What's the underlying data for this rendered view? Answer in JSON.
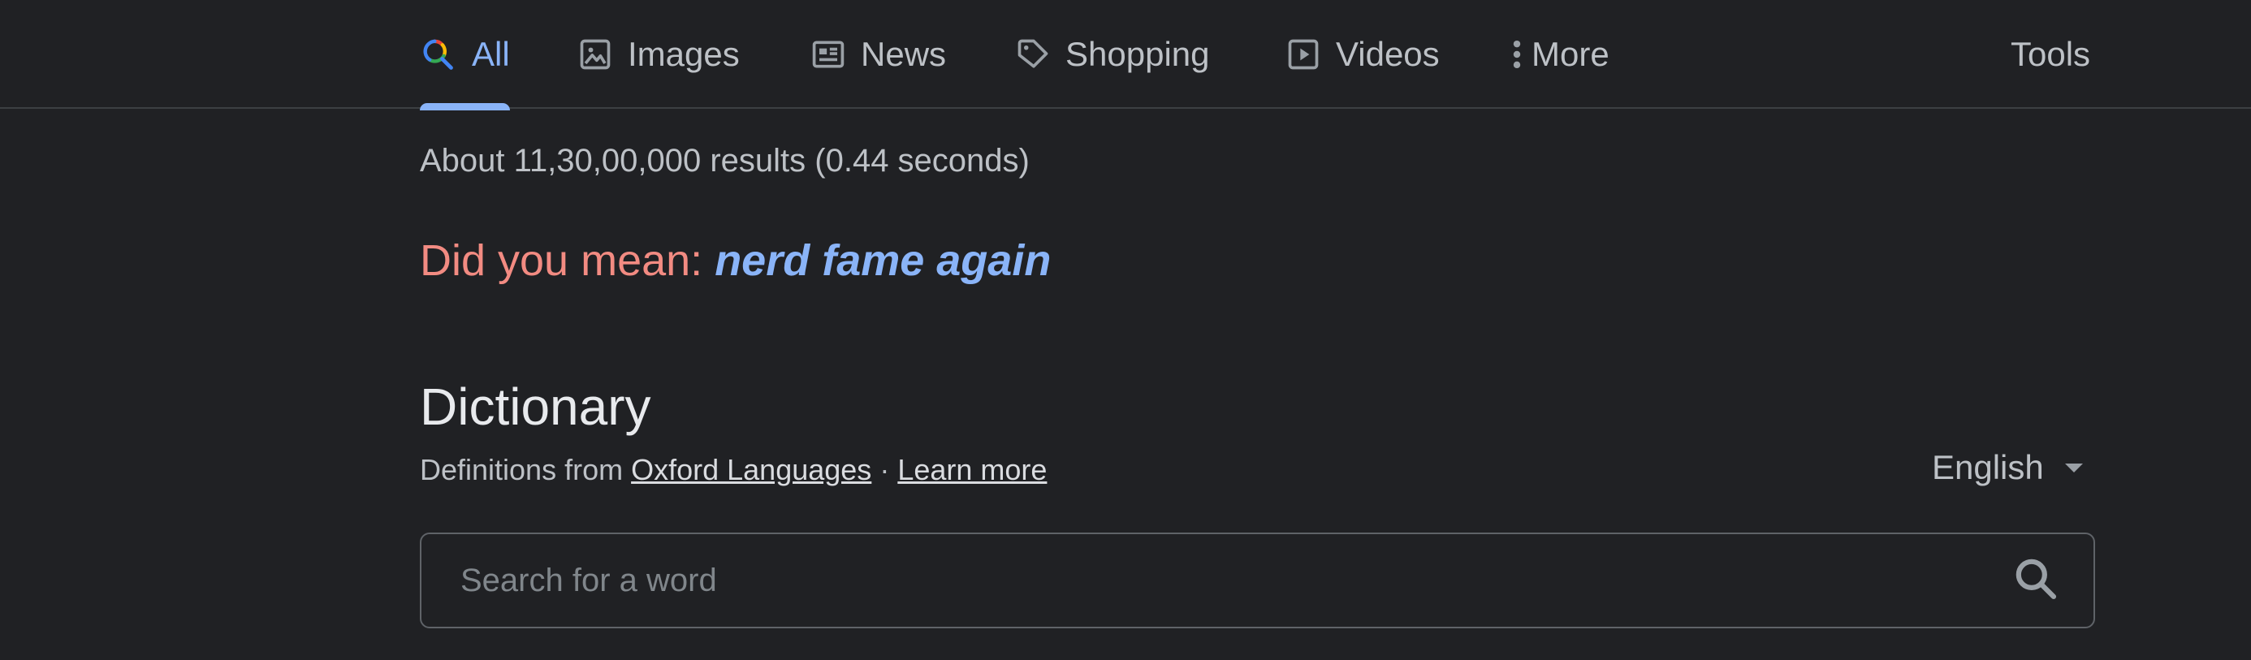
{
  "tabs": [
    {
      "label": "All",
      "icon": "google-search-icon",
      "active": true
    },
    {
      "label": "Images",
      "icon": "image-icon"
    },
    {
      "label": "News",
      "icon": "newspaper-icon"
    },
    {
      "label": "Shopping",
      "icon": "tag-icon"
    },
    {
      "label": "Videos",
      "icon": "play-icon"
    },
    {
      "label": "More",
      "icon": "more-vert-icon"
    }
  ],
  "tools_label": "Tools",
  "results_stats": "About 11,30,00,000 results (0.44 seconds)",
  "did_you_mean": {
    "prefix": "Did you mean: ",
    "suggestion": "nerd fame again"
  },
  "dictionary": {
    "title": "Dictionary",
    "source_prefix": "Definitions from ",
    "source_link": "Oxford Languages",
    "separator": " · ",
    "learn_more": "Learn more",
    "language": "English",
    "search_placeholder": "Search for a word",
    "search_value": ""
  },
  "colors": {
    "background": "#202124",
    "accent": "#8ab4f8",
    "did_you_mean": "#f28b82",
    "text_secondary": "#bdc1c6"
  }
}
